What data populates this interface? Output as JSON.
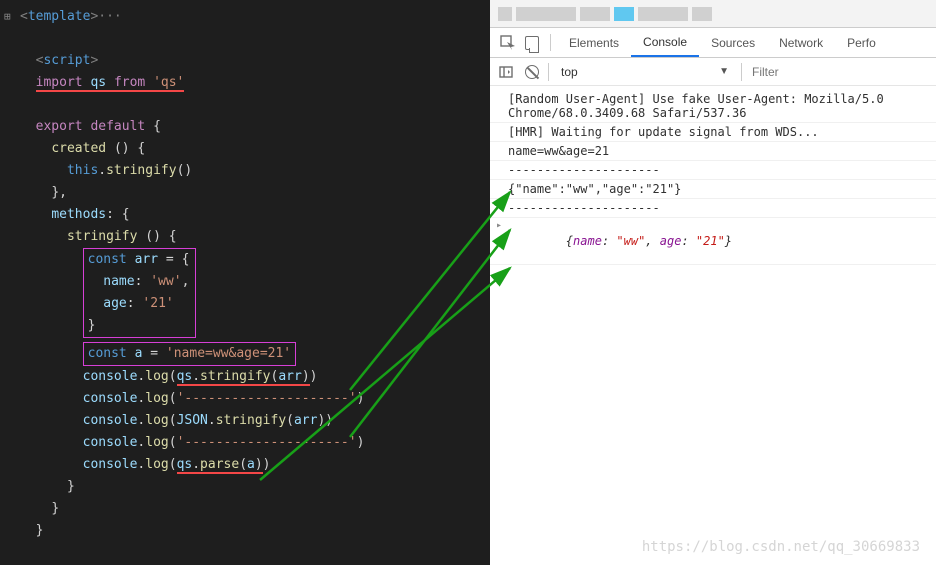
{
  "editor": {
    "fold_icon": "⊞",
    "template_open": "<",
    "template_elem": "template",
    "template_close": ">",
    "dots": "···",
    "script_open": "<",
    "script_elem": "script",
    "script_close": ">",
    "kw_import": "import",
    "import_id": "qs",
    "kw_from": "from",
    "import_str": "'qs'",
    "kw_export": "export",
    "kw_default": "default",
    "brace_open": "{",
    "created_name": "created",
    "parens": "()",
    "brace_open2": "{",
    "this_kw": "this",
    "dot": ".",
    "stringify_call": "stringify",
    "paren_empty": "()",
    "brace_close_comma": "},",
    "methods_key": "methods",
    "colon": ":",
    "brace_open3": "{",
    "stringify_name": "stringify",
    "kw_const": "const",
    "arr_id": "arr",
    "equals": "=",
    "obj_brace_open": "{",
    "name_key": "name",
    "name_val": "'ww'",
    "comma": ",",
    "age_key": "age",
    "age_val": "'21'",
    "obj_brace_close": "}",
    "a_id": "a",
    "a_val": "'name=ww&age=21'",
    "console_id": "console",
    "log_fn": "log",
    "qs_id": "qs",
    "stringify_fn": "stringify",
    "arr_arg": "arr",
    "dashes": "'---------------------'",
    "json_id": "JSON",
    "parse_fn": "parse",
    "a_arg": "a",
    "brace_close": "}",
    "brace_close2": "}",
    "brace_close3": "}"
  },
  "devtools": {
    "tabs": {
      "elements": "Elements",
      "console": "Console",
      "sources": "Sources",
      "network": "Network",
      "performance": "Perfo"
    },
    "sub": {
      "context": "top",
      "filter_placeholder": "Filter"
    },
    "console": {
      "line1": "[Random User-Agent] Use fake User-Agent: Mozilla/5.0 ",
      "line1b": "Chrome/68.0.3409.68 Safari/537.36",
      "line2": "[HMR] Waiting for update signal from WDS...",
      "out1": "name=ww&age=21",
      "dashes": "---------------------",
      "out2": "{\"name\":\"ww\",\"age\":\"21\"}",
      "obj_open": "{",
      "obj_k1": "name",
      "obj_sep": ": ",
      "obj_v1": "\"ww\"",
      "obj_comma": ", ",
      "obj_k2": "age",
      "obj_v2": "\"21\"",
      "obj_close": "}"
    },
    "watermark": "https://blog.csdn.net/qq_30669833"
  }
}
